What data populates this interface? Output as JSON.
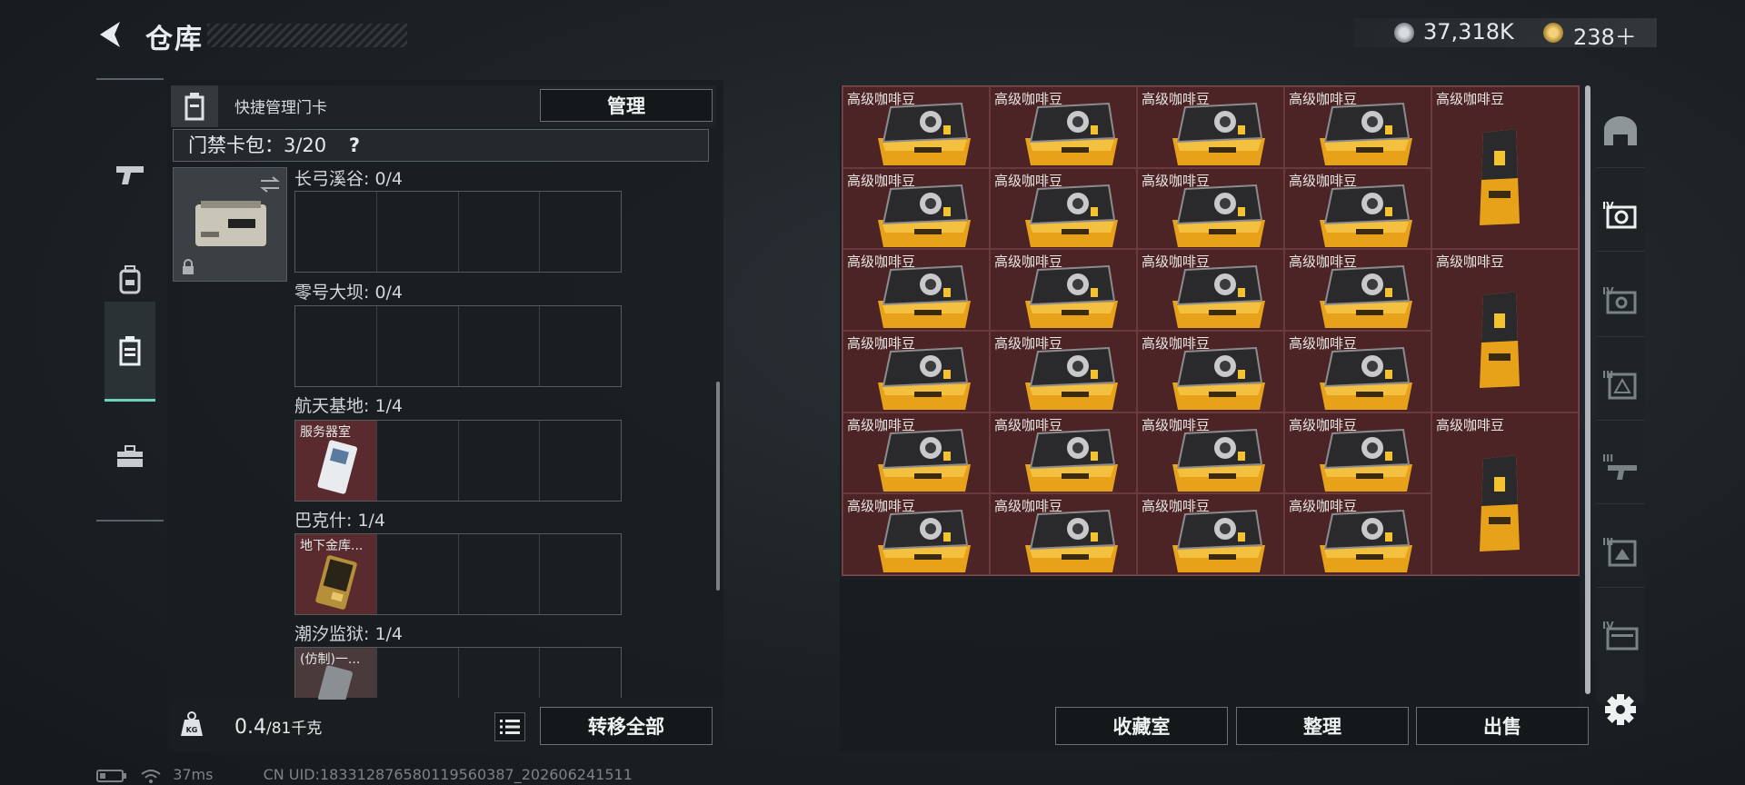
{
  "header": {
    "title": "仓库"
  },
  "currency": {
    "coins": "37,318K",
    "premium": "238＋"
  },
  "side_tabs": [
    {
      "name": "weapon-tab-icon"
    },
    {
      "name": "equipment-tab-icon"
    },
    {
      "name": "keycard-tab-icon",
      "active": true
    },
    {
      "name": "toolbox-tab-icon"
    }
  ],
  "key_panel": {
    "header_label": "快捷管理门卡",
    "manage_button": "管理",
    "card_pack_label": "门禁卡包：3/20",
    "card_pack_help": "?",
    "groups": [
      {
        "label": "长弓溪谷: 0/4",
        "slots": [
          "",
          "",
          "",
          ""
        ]
      },
      {
        "label": "零号大坝: 0/4",
        "slots": [
          "",
          "",
          "",
          ""
        ]
      },
      {
        "label": "航天基地: 1/4",
        "slots": [
          "服务器室",
          "",
          "",
          ""
        ]
      },
      {
        "label": "巴克什: 1/4",
        "slots": [
          "地下金库...",
          "",
          "",
          ""
        ]
      },
      {
        "label": "潮汐监狱: 1/4",
        "slots": [
          "(仿制)一...",
          "",
          "",
          ""
        ]
      }
    ]
  },
  "bottom_left": {
    "weight": "0.4",
    "weight_max": "/81千克",
    "transfer_button": "转移全部"
  },
  "status_bar": {
    "ping": "37ms",
    "uid": "CN UID:183312876580119560387_202606241511"
  },
  "inventory": {
    "item_name": "高级咖啡豆",
    "grid_cols": 5,
    "grid_rows": 6
  },
  "bottom_right": {
    "collection_button": "收藏室",
    "sort_button": "整理",
    "sell_button": "出售"
  },
  "colors": {
    "accent": "#6fd1b7",
    "item_bg": "#4c2426",
    "bag_gold": "#e8a21a"
  }
}
